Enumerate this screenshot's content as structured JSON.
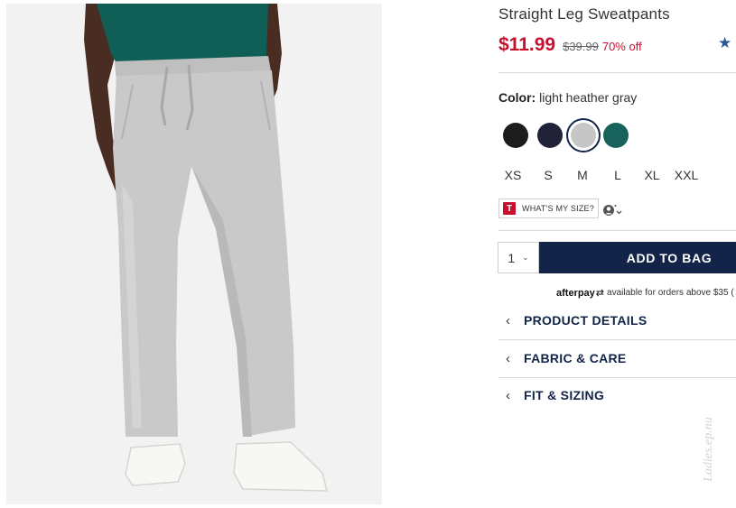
{
  "product": {
    "title": "Straight Leg Sweatpants",
    "price_sale": "$11.99",
    "price_original": "$39.99",
    "discount": "70% off",
    "rating_stars": "★"
  },
  "color": {
    "label": "Color:",
    "selected": "light heather gray",
    "swatches": [
      {
        "name": "black",
        "hex": "#1c1c1c"
      },
      {
        "name": "navy",
        "hex": "#202238"
      },
      {
        "name": "light heather gray",
        "hex": "#c6c6c6"
      },
      {
        "name": "green",
        "hex": "#17635c"
      }
    ]
  },
  "sizes": [
    "XS",
    "S",
    "M",
    "L",
    "XL",
    "XXL"
  ],
  "fit": {
    "logo_letter": "T",
    "button_label": "WHAT'S MY SIZE?"
  },
  "cart": {
    "quantity": "1",
    "add_label": "ADD TO BAG"
  },
  "afterpay": {
    "brand": "afterpay",
    "text": "available for orders above $35 ("
  },
  "accordion": [
    {
      "label": "PRODUCT DETAILS"
    },
    {
      "label": "FABRIC & CARE"
    },
    {
      "label": "FIT & SIZING"
    }
  ],
  "icons": {
    "accordion_chevron": "‹",
    "dropdown_chevron": "⌄",
    "afterpay_arrows": "⇄"
  },
  "watermark": "Ladies.ep.nu",
  "colors": {
    "brand_navy": "#122448",
    "sale_red": "#c8102e",
    "star_blue": "#2b5797"
  }
}
